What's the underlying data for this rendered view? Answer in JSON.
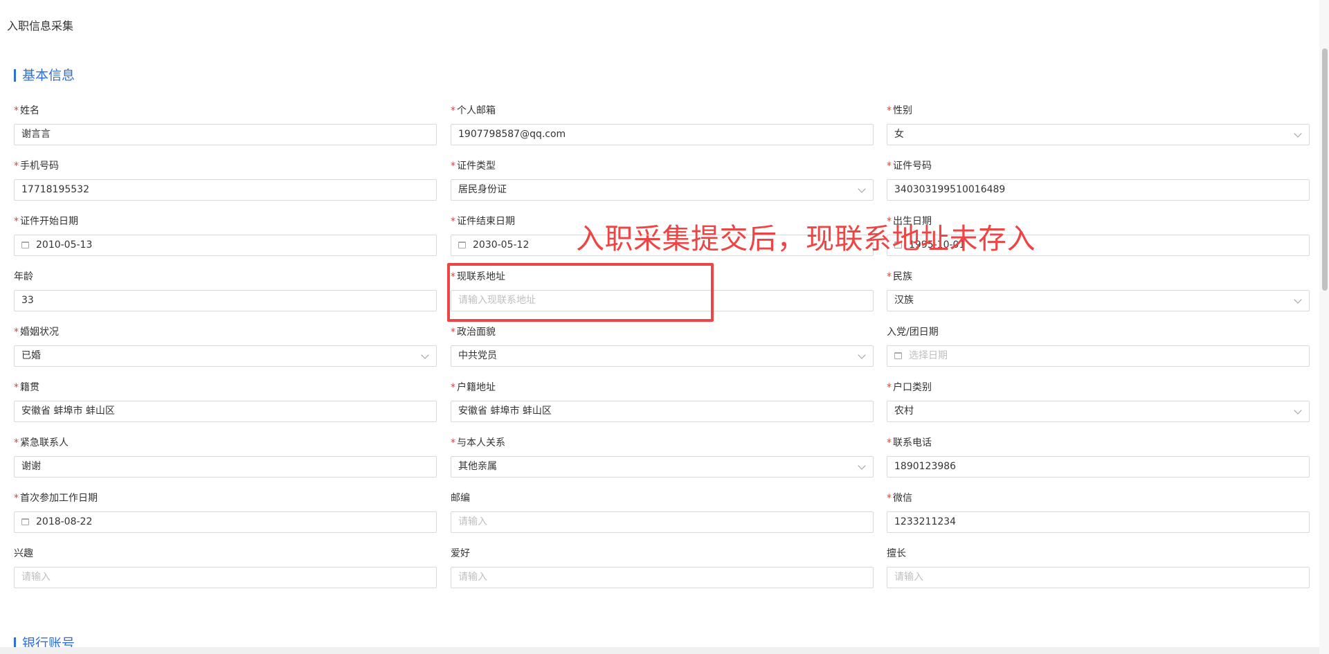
{
  "page": {
    "title": "入职信息采集"
  },
  "sections": {
    "basic": "基本信息",
    "bank": "银行账号"
  },
  "fields": [
    {
      "label": "姓名",
      "required": true,
      "kind": "input",
      "value": "谢言言"
    },
    {
      "label": "个人邮箱",
      "required": true,
      "kind": "input",
      "value": "1907798587@qq.com"
    },
    {
      "label": "性别",
      "required": true,
      "kind": "select",
      "value": "女"
    },
    {
      "label": "手机号码",
      "required": true,
      "kind": "input",
      "value": "17718195532"
    },
    {
      "label": "证件类型",
      "required": true,
      "kind": "select",
      "value": "居民身份证"
    },
    {
      "label": "证件号码",
      "required": true,
      "kind": "input",
      "value": "340303199510016489"
    },
    {
      "label": "证件开始日期",
      "required": true,
      "kind": "date",
      "value": "2010-05-13"
    },
    {
      "label": "证件结束日期",
      "required": true,
      "kind": "date",
      "value": "2030-05-12"
    },
    {
      "label": "出生日期",
      "required": true,
      "kind": "date",
      "value": "1995-10-01"
    },
    {
      "label": "年龄",
      "required": false,
      "kind": "input",
      "value": "33"
    },
    {
      "label": "现联系地址",
      "required": true,
      "kind": "input",
      "placeholder": "请输入现联系地址"
    },
    {
      "label": "民族",
      "required": true,
      "kind": "select",
      "value": "汉族"
    },
    {
      "label": "婚姻状况",
      "required": true,
      "kind": "select",
      "value": "已婚"
    },
    {
      "label": "政治面貌",
      "required": true,
      "kind": "select",
      "value": "中共党员"
    },
    {
      "label": "入党/团日期",
      "required": false,
      "kind": "date",
      "placeholder": "选择日期"
    },
    {
      "label": "籍贯",
      "required": true,
      "kind": "input",
      "value": "安徽省 蚌埠市 蚌山区"
    },
    {
      "label": "户籍地址",
      "required": true,
      "kind": "input",
      "value": "安徽省 蚌埠市 蚌山区"
    },
    {
      "label": "户口类别",
      "required": true,
      "kind": "select",
      "value": "农村"
    },
    {
      "label": "紧急联系人",
      "required": true,
      "kind": "input",
      "value": "谢谢"
    },
    {
      "label": "与本人关系",
      "required": true,
      "kind": "select",
      "value": "其他亲属"
    },
    {
      "label": "联系电话",
      "required": true,
      "kind": "input",
      "value": "1890123986"
    },
    {
      "label": "首次参加工作日期",
      "required": true,
      "kind": "date",
      "value": "2018-08-22"
    },
    {
      "label": "邮编",
      "required": false,
      "kind": "input",
      "placeholder": "请输入"
    },
    {
      "label": "微信",
      "required": true,
      "kind": "input",
      "value": "1233211234"
    },
    {
      "label": "兴趣",
      "required": false,
      "kind": "input",
      "placeholder": "请输入"
    },
    {
      "label": "爱好",
      "required": false,
      "kind": "input",
      "placeholder": "请输入"
    },
    {
      "label": "擅长",
      "required": false,
      "kind": "input",
      "placeholder": "请输入"
    }
  ],
  "annotation": {
    "text": "入职采集提交后，现联系地址未存入",
    "color": "#ee4444"
  },
  "colors": {
    "accent": "#2f6fd9",
    "required": "#ee3b3b"
  }
}
